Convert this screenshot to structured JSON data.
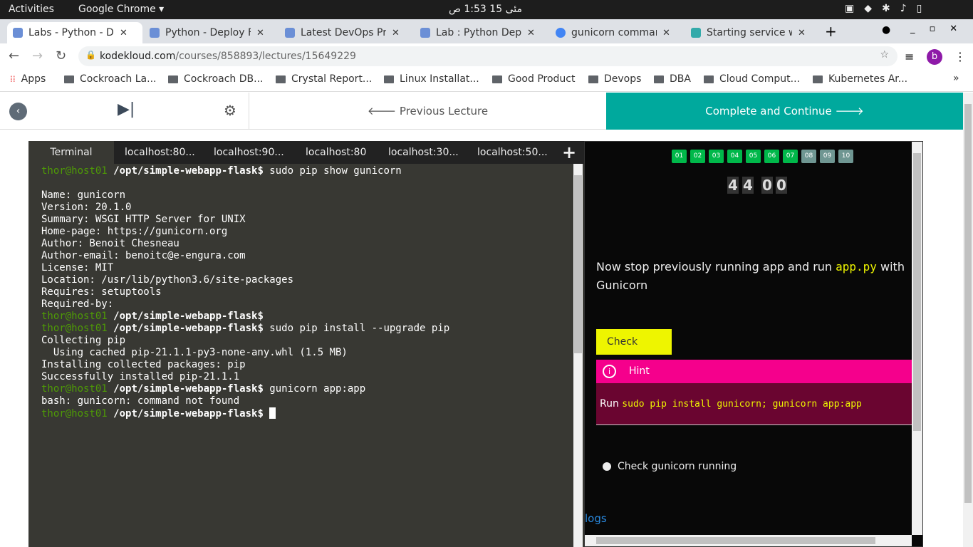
{
  "os": {
    "activities": "Activities",
    "app": "Google Chrome",
    "clock": "مئی 15  1:53 ص"
  },
  "tabs": [
    {
      "title": "Labs - Python - Dep"
    },
    {
      "title": "Python - Deploy Fla"
    },
    {
      "title": "Latest DevOps Pre"
    },
    {
      "title": "Lab : Python Deply"
    },
    {
      "title": "gunicorn comman"
    },
    {
      "title": "Starting service wi"
    }
  ],
  "url": {
    "domain": "kodekloud.com",
    "path": "/courses/858893/lectures/15649229"
  },
  "profile": "b",
  "bookmarks": [
    "Apps",
    "Cockroach La...",
    "Cockroach DB...",
    "Crystal Report...",
    "Linux Installat...",
    "Good Product",
    "Devops",
    "DBA",
    "Cloud Comput...",
    "Kubernetes Ar..."
  ],
  "nav": {
    "prev": "Previous Lecture",
    "next": "Complete and Continue"
  },
  "terminal": {
    "tabs": [
      "Terminal",
      "localhost:80...",
      "localhost:90...",
      "localhost:80",
      "localhost:30...",
      "localhost:50..."
    ],
    "prompt_user": "thor@host01",
    "prompt_path": "/opt/simple-webapp-flask$",
    "lines": [
      {
        "p": true,
        "t": " sudo pip show gunicorn"
      },
      {
        "t": ""
      },
      {
        "t": "Name: gunicorn"
      },
      {
        "t": "Version: 20.1.0"
      },
      {
        "t": "Summary: WSGI HTTP Server for UNIX"
      },
      {
        "t": "Home-page: https://gunicorn.org"
      },
      {
        "t": "Author: Benoit Chesneau"
      },
      {
        "t": "Author-email: benoitc@e-engura.com"
      },
      {
        "t": "License: MIT"
      },
      {
        "t": "Location: /usr/lib/python3.6/site-packages"
      },
      {
        "t": "Requires: setuptools"
      },
      {
        "t": "Required-by:"
      },
      {
        "p": true,
        "t": ""
      },
      {
        "p": true,
        "t": " sudo pip install --upgrade pip"
      },
      {
        "t": "Collecting pip"
      },
      {
        "t": "  Using cached pip-21.1.1-py3-none-any.whl (1.5 MB)"
      },
      {
        "t": "Installing collected packages: pip"
      },
      {
        "t": "Successfully installed pip-21.1.1"
      },
      {
        "p": true,
        "t": " gunicorn app:app"
      },
      {
        "t": "bash: gunicorn: command not found"
      },
      {
        "p": true,
        "t": " ",
        "cursor": true
      }
    ]
  },
  "lab": {
    "questions": [
      {
        "n": "01",
        "done": true
      },
      {
        "n": "02",
        "done": true
      },
      {
        "n": "03",
        "done": true
      },
      {
        "n": "04",
        "done": true
      },
      {
        "n": "05",
        "done": true
      },
      {
        "n": "06",
        "done": true
      },
      {
        "n": "07",
        "done": true
      },
      {
        "n": "08",
        "done": false
      },
      {
        "n": "09",
        "done": false
      },
      {
        "n": "10",
        "done": false
      }
    ],
    "timer": [
      "4",
      "4",
      "0",
      "0"
    ],
    "question_pre": "Now stop previously running app and run ",
    "question_code": "app.py",
    "question_post": " with Gunicorn",
    "check": "Check",
    "hint_title": "Hint",
    "hint_run": "Run ",
    "hint_cmd": "sudo pip install gunicorn; gunicorn app:app",
    "task": "Check gunicorn running",
    "logs": "logs"
  },
  "colors": {
    "done": "#00b84a",
    "todo": "#6f9692",
    "check": "#eef500",
    "hint": "#f5008c",
    "hintBody": "#6a0530",
    "teal": "#00a99d"
  }
}
